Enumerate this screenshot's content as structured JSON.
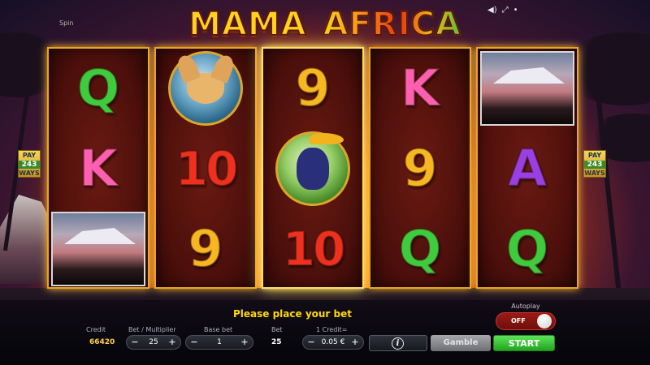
{
  "title": {
    "word1": "MAMA",
    "word2": "AFRICA"
  },
  "corner_tag": "Spin",
  "sound_controls": {
    "icons": [
      "speaker-icon",
      "fullscreen-icon",
      "settings-icon"
    ]
  },
  "pay_ways": {
    "top": "PAY",
    "number": "243",
    "bottom": "WAYS"
  },
  "reels": [
    {
      "symbols": [
        {
          "type": "letter",
          "text": "Q",
          "color": "#3ecb3e"
        },
        {
          "type": "letter",
          "text": "K",
          "color": "#ff5fb0"
        },
        {
          "type": "picture",
          "name": "kilimanjaro"
        }
      ]
    },
    {
      "symbols": [
        {
          "type": "animal",
          "name": "fennec-fox"
        },
        {
          "type": "number",
          "text": "10"
        },
        {
          "type": "number",
          "text": "9"
        }
      ]
    },
    {
      "symbols": [
        {
          "type": "number",
          "text": "9"
        },
        {
          "type": "animal",
          "name": "hornbill"
        },
        {
          "type": "number",
          "text": "10"
        }
      ]
    },
    {
      "symbols": [
        {
          "type": "letter",
          "text": "K"
        },
        {
          "type": "number",
          "text": "9"
        },
        {
          "type": "letter",
          "text": "Q"
        }
      ]
    },
    {
      "symbols": [
        {
          "type": "picture",
          "name": "kilimanjaro"
        },
        {
          "type": "letter",
          "text": "A"
        },
        {
          "type": "letter",
          "text": "Q"
        }
      ]
    }
  ],
  "message": "Please place your bet",
  "autoplay": {
    "label": "Autoplay",
    "state": "OFF"
  },
  "controls": {
    "credit_label": "Credit",
    "credit_value": "66420",
    "bet_multiplier_label": "Bet / Multiplier",
    "bet_multiplier_value": "25",
    "base_bet_label": "Base bet",
    "base_bet_value": "1",
    "bet_label": "Bet",
    "bet_value": "25",
    "credit_rate_label": "1 Credit=",
    "credit_rate_value": "0.05 €",
    "minus": "−",
    "plus": "+"
  },
  "buttons": {
    "info": "i",
    "gamble": "Gamble",
    "start": "START"
  }
}
